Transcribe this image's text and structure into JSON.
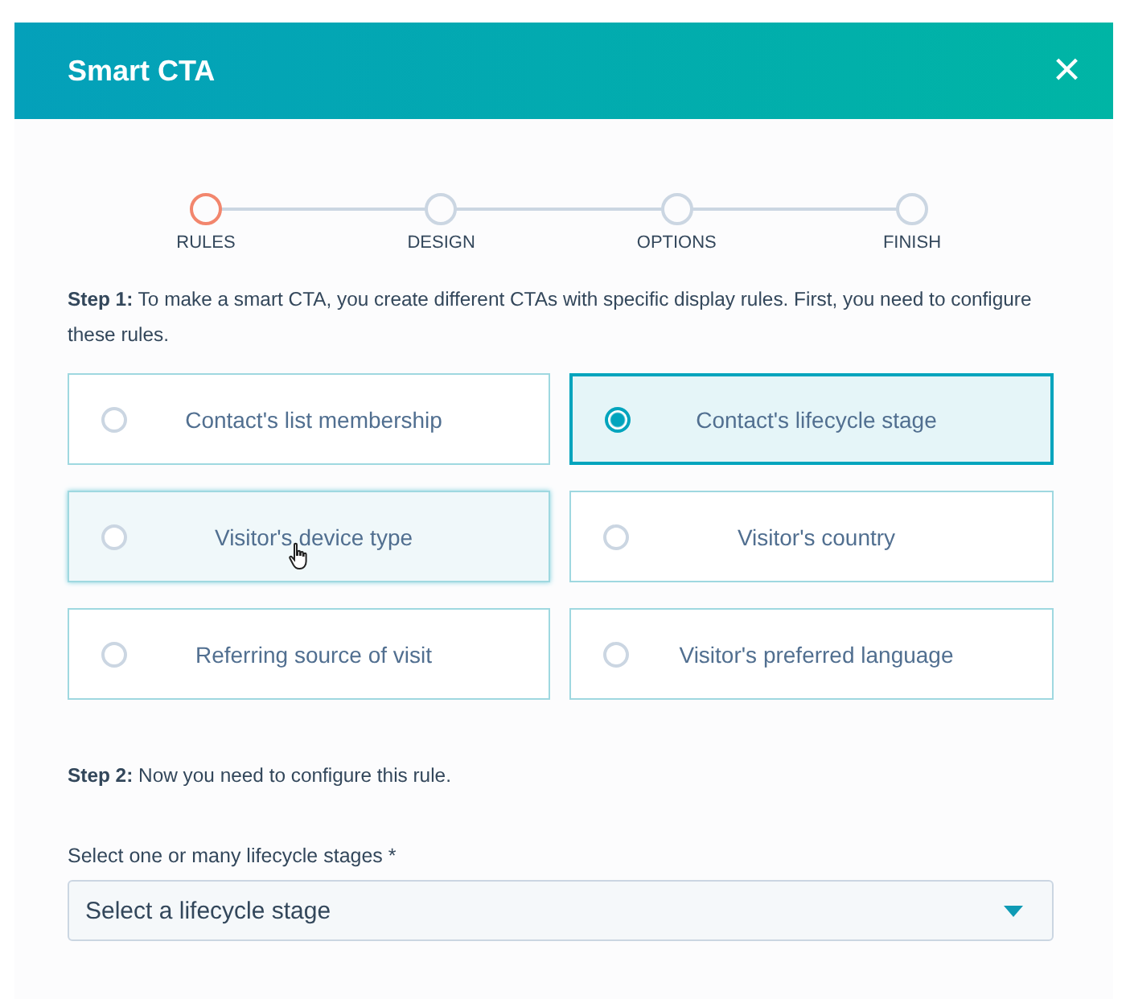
{
  "modal": {
    "title": "Smart CTA",
    "close_icon": "×"
  },
  "steps": [
    {
      "label": "RULES",
      "selected": true
    },
    {
      "label": "DESIGN",
      "selected": false
    },
    {
      "label": "OPTIONS",
      "selected": false
    },
    {
      "label": "FINISH",
      "selected": false
    }
  ],
  "step1_text": "**Step 1:** To make a smart CTA, you create different CTAs with specific display rules. First, you need to configure these rules.",
  "rule_options": [
    {
      "label": "Contact's list membership",
      "selected": false,
      "hovered": false
    },
    {
      "label": "Contact's lifecycle stage",
      "selected": true,
      "hovered": false
    },
    {
      "label": "Visitor's device type",
      "selected": false,
      "hovered": true
    },
    {
      "label": "Visitor's country",
      "selected": false,
      "hovered": false
    },
    {
      "label": "Referring source of visit",
      "selected": false,
      "hovered": false
    },
    {
      "label": "Visitor's preferred language",
      "selected": false,
      "hovered": false
    }
  ],
  "step2_text": "**Step 2:** Now you need to configure this rule.",
  "field": {
    "label": "Select one or many lifecycle stages *",
    "placeholder": "Select a lifecycle stage"
  }
}
